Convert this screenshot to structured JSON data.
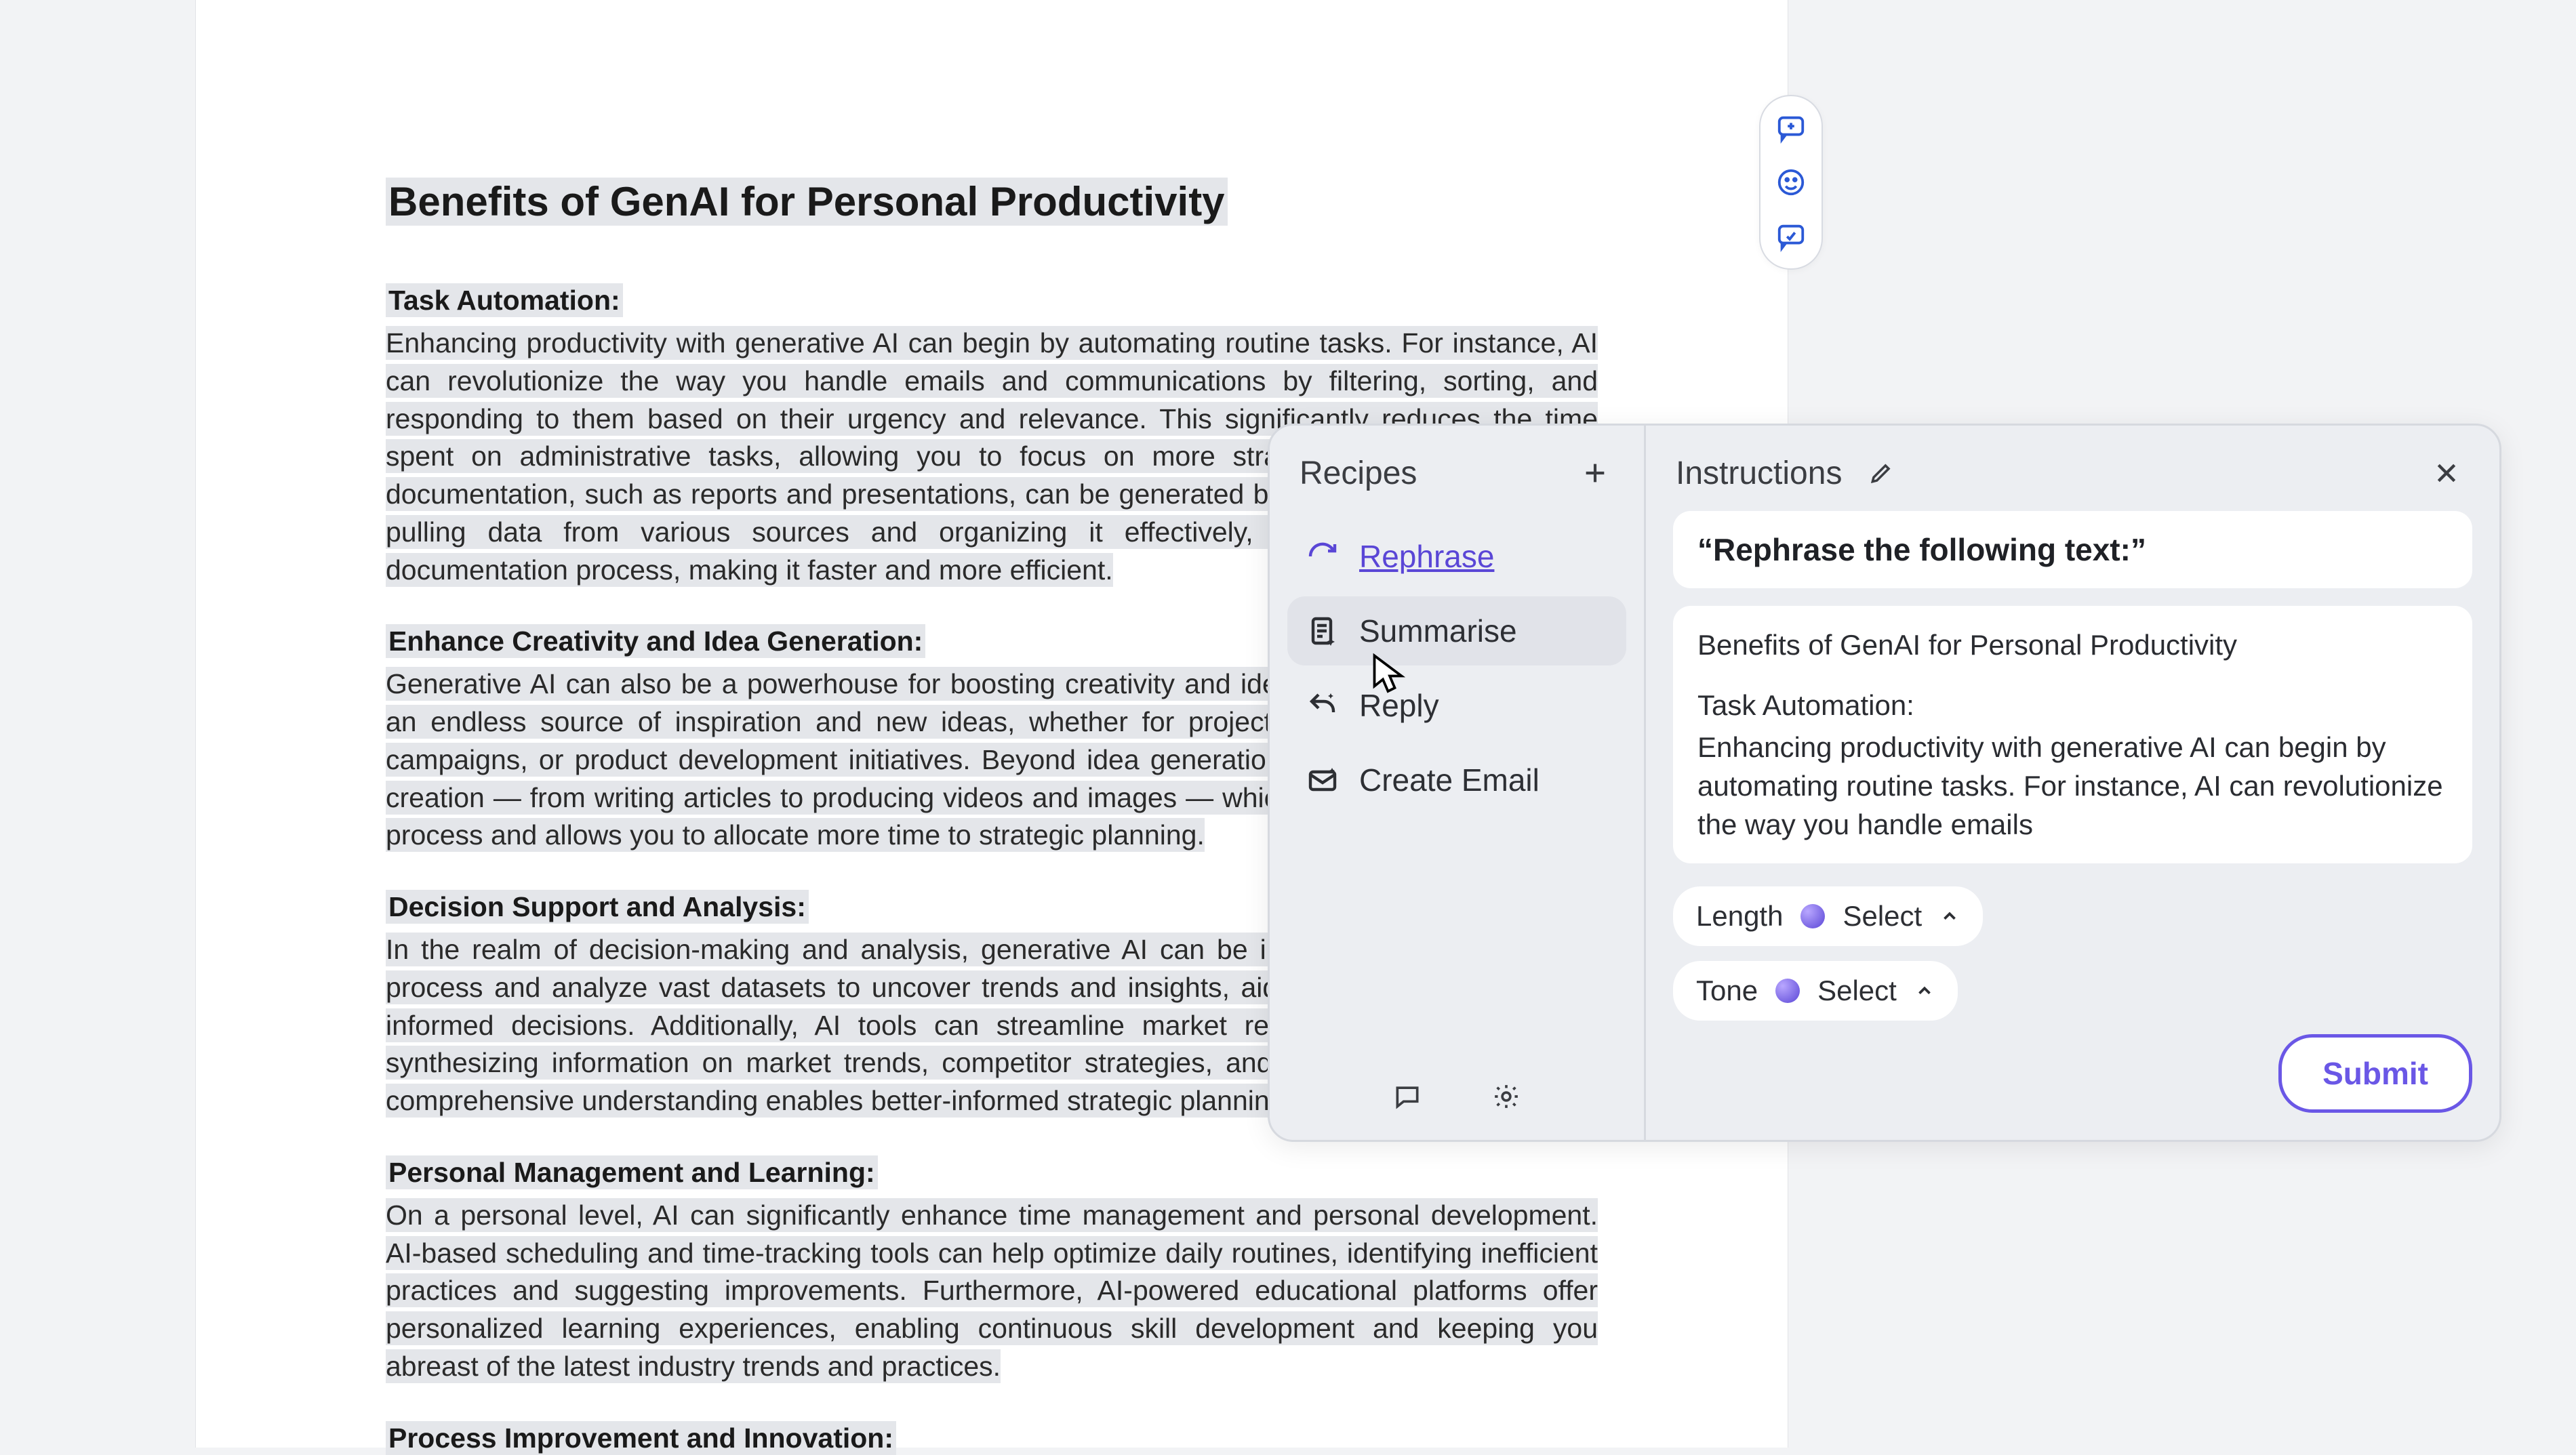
{
  "document": {
    "title": "Benefits of GenAI for Personal Productivity",
    "sections": [
      {
        "heading": "Task Automation:",
        "body": "Enhancing productivity with generative AI can begin by automating routine tasks. For instance, AI can revolutionize the way you handle emails and communications by filtering, sorting, and responding to them based on their urgency and relevance. This significantly reduces the time spent on administrative tasks, allowing you to focus on more strategic activities. Similarly, documentation, such as reports and presentations, can be generated by AI with minimal input. By pulling data from various sources and organizing it effectively, AI helps streamline the documentation process, making it faster and more efficient."
      },
      {
        "heading": "Enhance Creativity and Idea Generation:",
        "body": "Generative AI can also be a powerhouse for boosting creativity and idea generation. It serves as an endless source of inspiration and new ideas, whether for project brainstorming, marketing campaigns, or product development initiatives. Beyond idea generation, AI can assist in content creation — from writing articles to producing videos and images — which accelerates the creative process and allows you to allocate more time to strategic planning."
      },
      {
        "heading": "Decision Support and Analysis:",
        "body": "In the realm of decision-making and analysis, generative AI can be instrumental. It can rapidly process and analyze vast datasets to uncover trends and insights, aiding in more accurate and informed decisions. Additionally, AI tools can streamline market research by compiling and synthesizing information on market trends, competitor strategies, and customer feedback. This comprehensive understanding enables better-informed strategic planning."
      },
      {
        "heading": "Personal Management and Learning:",
        "body": "On a personal level, AI can significantly enhance time management and personal development. AI-based scheduling and time-tracking tools can help optimize daily routines, identifying inefficient practices and suggesting improvements. Furthermore, AI-powered educational platforms offer personalized learning experiences, enabling continuous skill development and keeping you abreast of the latest industry trends and practices."
      },
      {
        "heading": "Process Improvement and Innovation:",
        "body": ""
      }
    ]
  },
  "side_rail": {
    "add_comment": "add-comment",
    "emoji": "emoji",
    "suggest": "suggest-edit"
  },
  "panel": {
    "recipes_title": "Recipes",
    "instructions_title": "Instructions",
    "recipes": [
      {
        "id": "rephrase",
        "label": "Rephrase",
        "active": true,
        "hover": false
      },
      {
        "id": "summarise",
        "label": "Summarise",
        "active": false,
        "hover": true
      },
      {
        "id": "reply",
        "label": "Reply",
        "active": false,
        "hover": false
      },
      {
        "id": "create-email",
        "label": "Create Email",
        "active": false,
        "hover": false
      }
    ],
    "instruction_text": "“Rephrase the following text:”",
    "preview": {
      "title": "Benefits of GenAI for Personal Productivity",
      "subhead": "Task Automation:",
      "body": "Enhancing productivity with generative AI can begin by automating routine tasks. For instance, AI can revolutionize the way you handle emails"
    },
    "length_label": "Length",
    "tone_label": "Tone",
    "select_label": "Select",
    "submit_label": "Submit"
  }
}
